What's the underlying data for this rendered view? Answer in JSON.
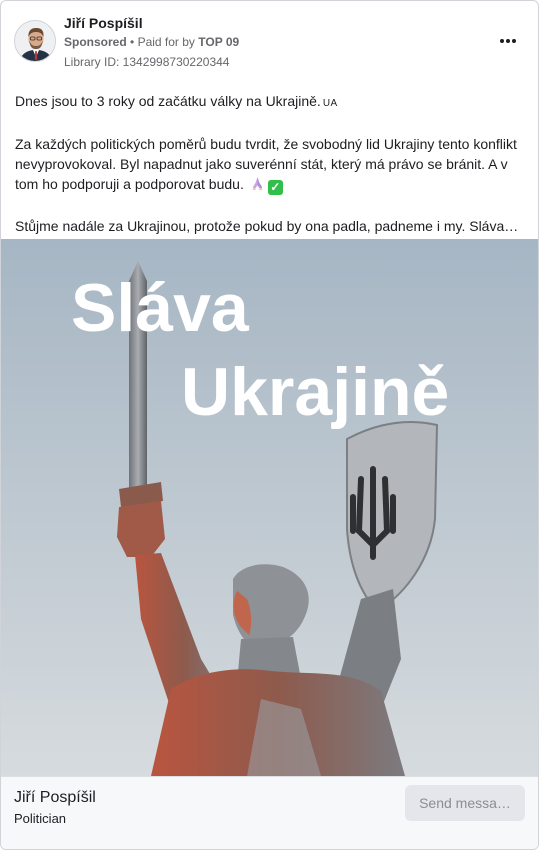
{
  "advertiser": {
    "name": "Jiří Pospíšil",
    "sponsored_label": "Sponsored",
    "separator": "•",
    "paid_for_prefix": "Paid for by",
    "paid_for_by": "TOP 09",
    "library_id": "Library ID: 1342998730220344"
  },
  "post": {
    "line1": "Dnes jsou to 3 roky od začátku války na Ukrajině.",
    "flag_text": "UA",
    "paragraph2": "Za každých politických poměrů budu tvrdit, že svobodný lid Ukrajiny tento konflikt nevyprovokoval. Byl napadnut jako suverénní stát, který má právo se bránit. A v tom ho podporuji a podporovat budu.",
    "check_glyph": "✓",
    "paragraph3": "Stůjme nadále za Ukrajinou, protože pokud by ona padla, padneme i my. Sláva…"
  },
  "image": {
    "overlay_line1": "Sláva",
    "overlay_line2": "Ukrajině"
  },
  "footer": {
    "page_name": "Jiří Pospíšil",
    "page_category": "Politician",
    "cta_label": "Send messa…"
  },
  "icons": {
    "more": "more-options-icon",
    "pray": "pray-icon",
    "check": "check-mark-icon"
  },
  "colors": {
    "sky_top": "#a8b8c6",
    "sky_bottom": "#cfd6da",
    "statue_metal": "#8b8f94",
    "cta_bg": "#e4e6eb"
  }
}
